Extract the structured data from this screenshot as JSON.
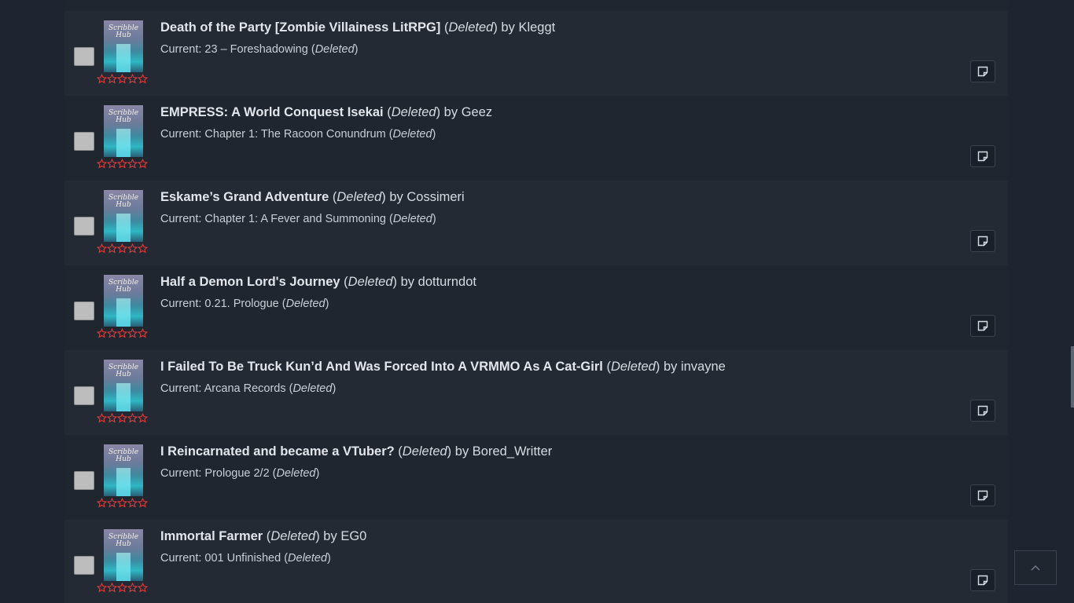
{
  "entries": [
    {
      "title": "",
      "deleted_word": "Deleted",
      "by": "",
      "author": "",
      "current_prefix": "",
      "current_chapter": "",
      "partial": true
    },
    {
      "title": "Death of the Party [Zombie Villainess LitRPG]",
      "deleted_word": "Deleted",
      "by": "by",
      "author": "Kleggt",
      "current_prefix": "Current:",
      "current_chapter": "23 – Foreshadowing"
    },
    {
      "title": "EMPRESS: A World Conquest Isekai",
      "deleted_word": "Deleted",
      "by": "by",
      "author": "Geez",
      "current_prefix": "Current:",
      "current_chapter": "Chapter 1: The Racoon Conundrum"
    },
    {
      "title": "Eskame’s Grand Adventure",
      "deleted_word": "Deleted",
      "by": "by",
      "author": "Cossimeri",
      "current_prefix": "Current:",
      "current_chapter": "Chapter 1: A Fever and Summoning "
    },
    {
      "title": "Half a Demon Lord's Journey",
      "deleted_word": "Deleted",
      "by": "by",
      "author": "dotturndot",
      "current_prefix": "Current:",
      "current_chapter": "0.21. Prologue"
    },
    {
      "title": "I Failed To Be Truck Kun’d And Was Forced Into A VRMMO As A Cat-Girl",
      "deleted_word": "Deleted",
      "by": "by",
      "author": "invayne",
      "current_prefix": "Current:",
      "current_chapter": "Arcana Records"
    },
    {
      "title": "I Reincarnated and became a VTuber?",
      "deleted_word": "Deleted",
      "by": "by",
      "author": "Bored_Writter",
      "current_prefix": "Current:",
      "current_chapter": "Prologue 2/2"
    },
    {
      "title": "Immortal Farmer",
      "deleted_word": "Deleted",
      "by": "by",
      "author": "EG0",
      "current_prefix": "Current:",
      "current_chapter": "001 Unfinished"
    }
  ],
  "cover": {
    "title_text": "Scribble Hub",
    "icon": "book-cover-image"
  },
  "rating": {
    "stars_total": 5,
    "stars_filled": 0,
    "star_color": "#e03a3a"
  },
  "icons": {
    "note": "note-icon",
    "back_to_top": "chevron-up-icon"
  },
  "colors": {
    "bg": "#1e2530",
    "row_odd": "#232a34",
    "row_even": "#1f2630",
    "text": "#d6dbe2"
  }
}
